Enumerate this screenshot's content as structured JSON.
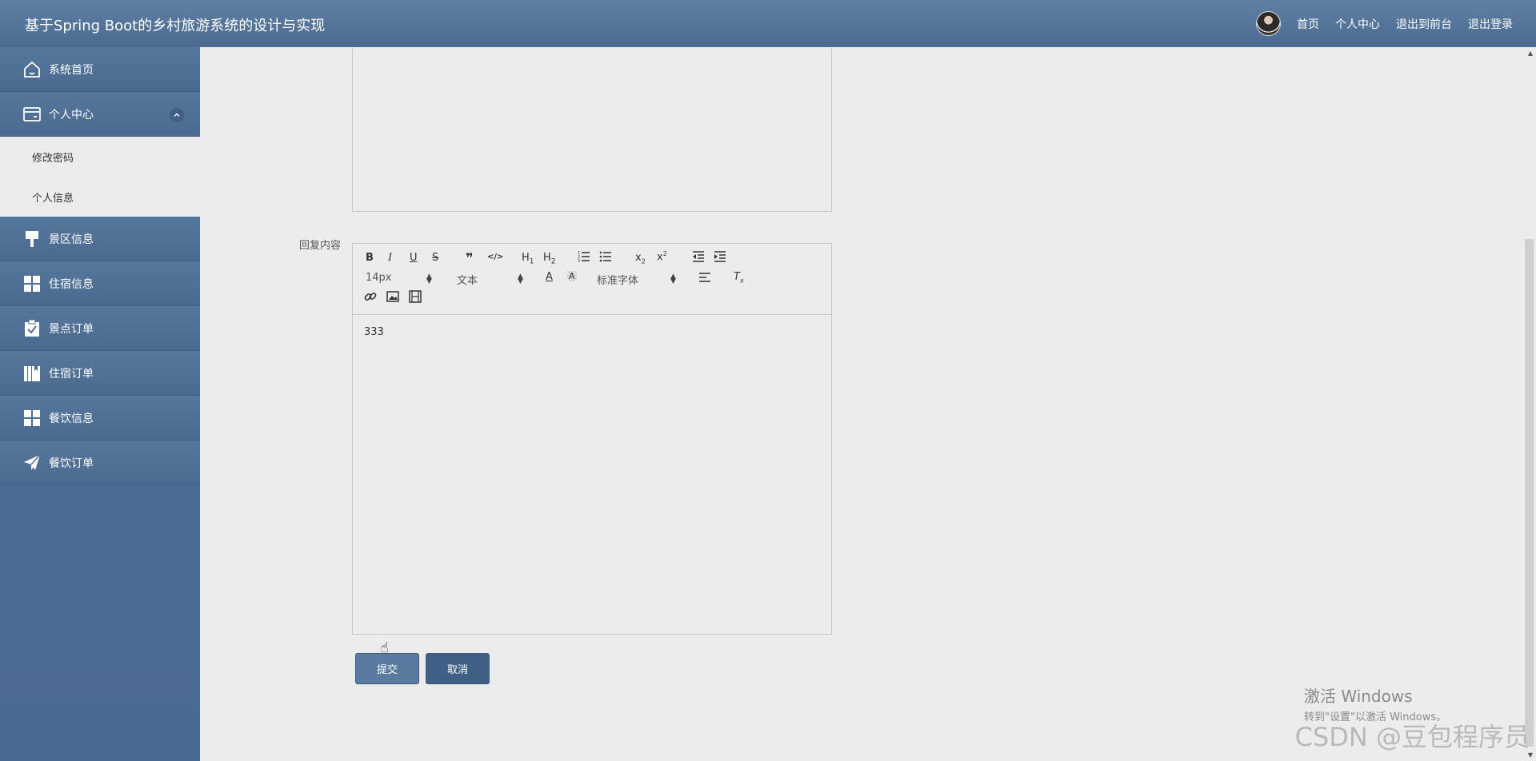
{
  "header": {
    "title": "基于Spring Boot的乡村旅游系统的设计与实现",
    "links": [
      "首页",
      "个人中心",
      "退出到前台",
      "退出登录"
    ]
  },
  "sidebar": {
    "items": [
      {
        "label": "系统首页",
        "icon": "home-icon"
      },
      {
        "label": "个人中心",
        "icon": "card-icon",
        "expanded": true,
        "children": [
          "修改密码",
          "个人信息"
        ]
      },
      {
        "label": "景区信息",
        "icon": "brush-icon"
      },
      {
        "label": "住宿信息",
        "icon": "grid-icon"
      },
      {
        "label": "景点订单",
        "icon": "clipboard-check-icon"
      },
      {
        "label": "住宿订单",
        "icon": "books-icon"
      },
      {
        "label": "餐饮信息",
        "icon": "grid-icon"
      },
      {
        "label": "餐饮订单",
        "icon": "paper-plane-icon"
      }
    ]
  },
  "form": {
    "reply_label": "回复内容",
    "editor": {
      "font_size": "14px",
      "paragraph": "文本",
      "font_family": "标准字体",
      "content": "333"
    },
    "submit_label": "提交",
    "cancel_label": "取消"
  },
  "watermark": {
    "title": "激活 Windows",
    "subtitle": "转到\"设置\"以激活 Windows。",
    "csdn": "CSDN @豆包程序员"
  }
}
